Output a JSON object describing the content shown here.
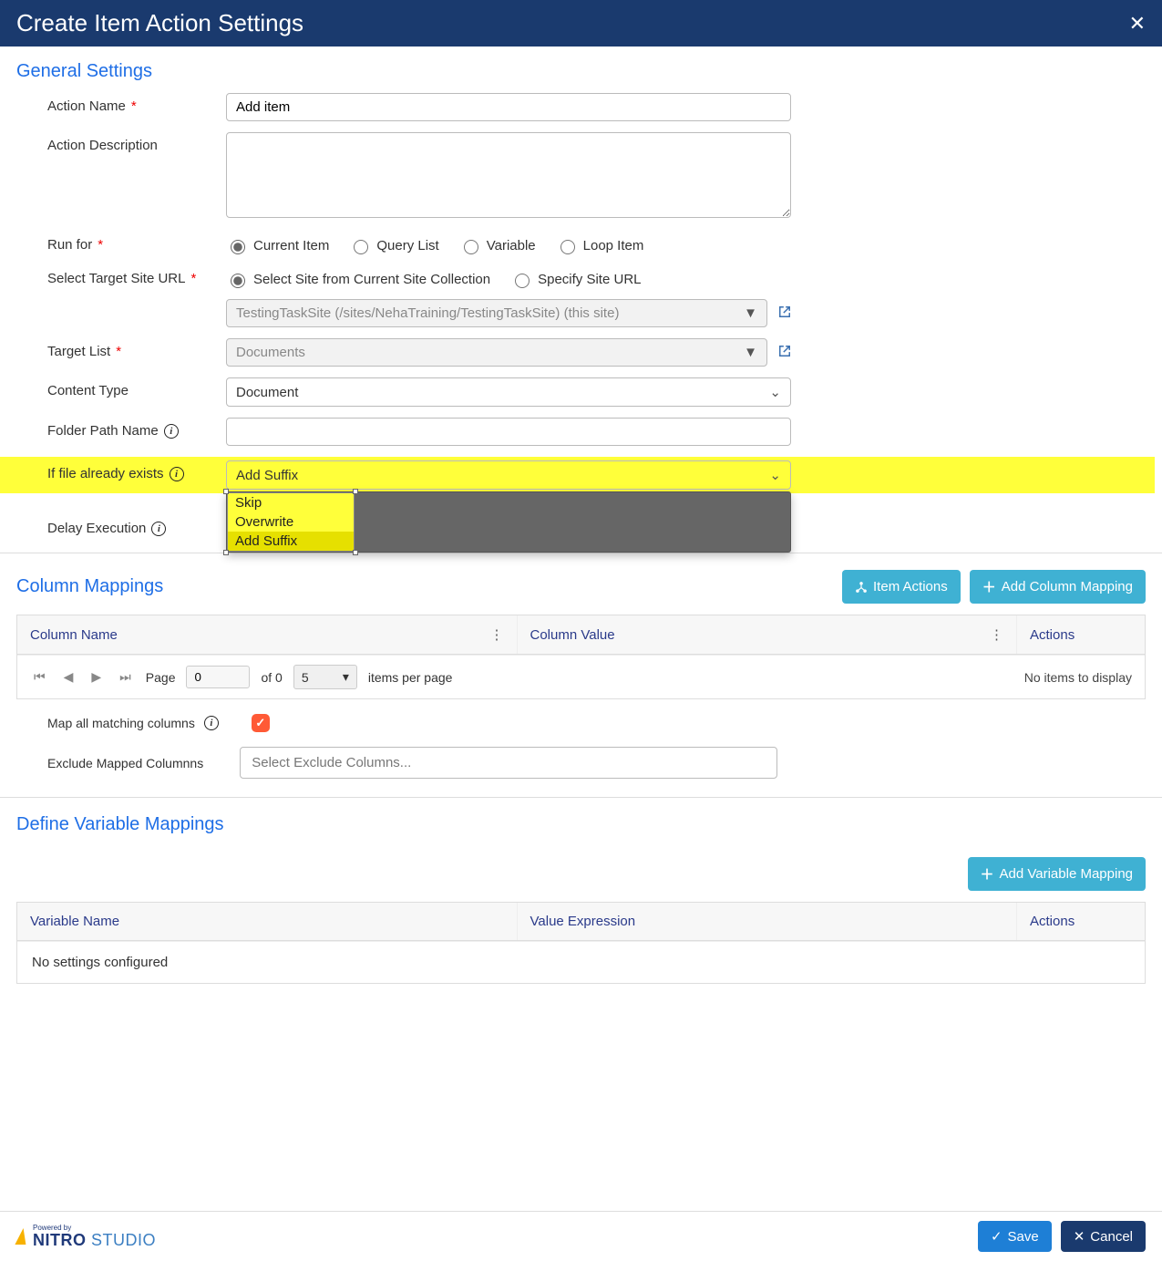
{
  "header": {
    "title": "Create Item Action Settings"
  },
  "general": {
    "title": "General Settings",
    "action_name": {
      "label": "Action Name",
      "value": "Add item"
    },
    "action_desc": {
      "label": "Action Description",
      "value": ""
    },
    "run_for": {
      "label": "Run for",
      "options": [
        "Current Item",
        "Query List",
        "Variable",
        "Loop Item"
      ],
      "selected": "Current Item"
    },
    "target_site_url": {
      "label": "Select Target Site URL",
      "mode_options": [
        "Select Site from Current Site Collection",
        "Specify Site URL"
      ],
      "mode_selected": "Select Site from Current Site Collection",
      "site_value": "TestingTaskSite (/sites/NehaTraining/TestingTaskSite) (this site)"
    },
    "target_list": {
      "label": "Target List",
      "value": "Documents"
    },
    "content_type": {
      "label": "Content Type",
      "value": "Document"
    },
    "folder_path": {
      "label": "Folder Path Name",
      "value": ""
    },
    "file_exists": {
      "label": "If file already exists",
      "value": "Add Suffix",
      "options": [
        "Skip",
        "Overwrite",
        "Add Suffix"
      ]
    },
    "delay_exec": {
      "label": "Delay Execution",
      "value": ""
    }
  },
  "column_mappings": {
    "title": "Column Mappings",
    "item_actions_btn": "Item Actions",
    "add_btn": "Add Column Mapping",
    "headers": [
      "Column Name",
      "Column Value",
      "Actions"
    ],
    "pager": {
      "page_label": "Page",
      "page_value": "0",
      "of_label": "of 0",
      "size_value": "5",
      "items_label": "items per page",
      "no_items": "No items to display"
    },
    "map_all": {
      "label": "Map all matching columns",
      "checked": true
    },
    "exclude": {
      "label": "Exclude Mapped Columnns",
      "placeholder": "Select Exclude Columns..."
    }
  },
  "variable_mappings": {
    "title": "Define Variable Mappings",
    "add_btn": "Add Variable Mapping",
    "headers": [
      "Variable Name",
      "Value Expression",
      "Actions"
    ],
    "empty": "No settings configured"
  },
  "footer": {
    "powered_by": "Powered by",
    "brand_1": "NITRO",
    "brand_2": "STUDIO",
    "save": "Save",
    "cancel": "Cancel"
  }
}
